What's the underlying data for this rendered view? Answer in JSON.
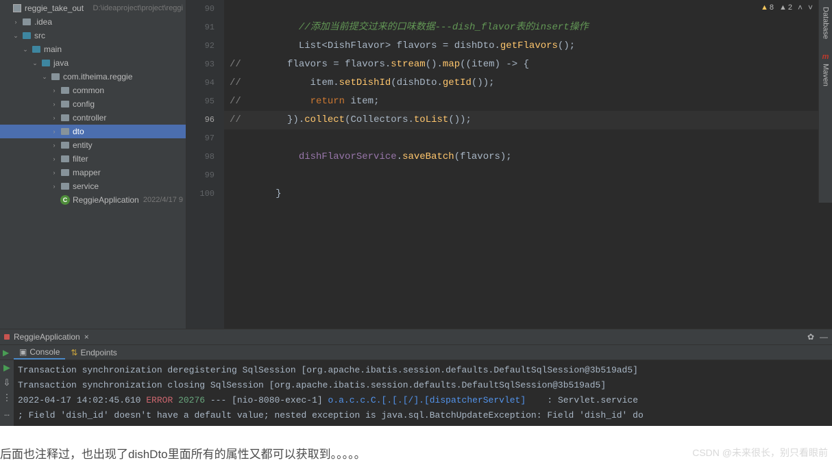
{
  "project": {
    "root": {
      "name": "reggie_take_out",
      "path": "D:\\ideaproject\\project\\reggi"
    },
    "tree": [
      {
        "depth": 0,
        "arrow": "",
        "icon": "module",
        "label": "reggie_take_out",
        "meta": "D:\\ideaproject\\project\\reggi"
      },
      {
        "depth": 1,
        "arrow": ">",
        "icon": "folder",
        "label": ".idea"
      },
      {
        "depth": 1,
        "arrow": "v",
        "icon": "src",
        "label": "src"
      },
      {
        "depth": 2,
        "arrow": "v",
        "icon": "src",
        "label": "main"
      },
      {
        "depth": 3,
        "arrow": "v",
        "icon": "src",
        "label": "java"
      },
      {
        "depth": 4,
        "arrow": "v",
        "icon": "pkg",
        "label": "com.itheima.reggie"
      },
      {
        "depth": 5,
        "arrow": ">",
        "icon": "pkg",
        "label": "common"
      },
      {
        "depth": 5,
        "arrow": ">",
        "icon": "pkg",
        "label": "config"
      },
      {
        "depth": 5,
        "arrow": ">",
        "icon": "pkg",
        "label": "controller"
      },
      {
        "depth": 5,
        "arrow": ">",
        "icon": "pkg",
        "label": "dto",
        "selected": true
      },
      {
        "depth": 5,
        "arrow": ">",
        "icon": "pkg",
        "label": "entity"
      },
      {
        "depth": 5,
        "arrow": ">",
        "icon": "pkg",
        "label": "filter"
      },
      {
        "depth": 5,
        "arrow": ">",
        "icon": "pkg",
        "label": "mapper"
      },
      {
        "depth": 5,
        "arrow": ">",
        "icon": "pkg",
        "label": "service"
      },
      {
        "depth": 5,
        "arrow": "",
        "icon": "cls",
        "label": "ReggieApplication",
        "meta": "2022/4/17 9"
      }
    ]
  },
  "right_tools": {
    "database": "Database",
    "maven": "Maven"
  },
  "editor": {
    "warnings": {
      "yellow": "8",
      "grey": "2"
    },
    "current_line": 96,
    "lines": [
      {
        "n": 90,
        "raw": ""
      },
      {
        "n": 91,
        "comment_zh": "//添加当前提交过来的口味数据---dish_flavor表的insert操作"
      },
      {
        "n": 92,
        "code_html": "List&lt;DishFlavor&gt; flavors = dishDto.getFlavors();"
      },
      {
        "n": 93,
        "code_html": "//        flavors = flavors.stream().map((item) -> {"
      },
      {
        "n": 94,
        "code_html": "//            item.setDishId(dishDto.getId());"
      },
      {
        "n": 95,
        "code_html": "//            return item;"
      },
      {
        "n": 96,
        "code_html": "//        }).collect(Collectors.toList());"
      },
      {
        "n": 97,
        "raw": ""
      },
      {
        "n": 98,
        "code_html": "dishFlavorService.saveBatch(flavors);"
      },
      {
        "n": 99,
        "raw": ""
      },
      {
        "n": 100,
        "raw": "}"
      }
    ]
  },
  "run": {
    "title": "ReggieApplication",
    "tabs": {
      "console": "Console",
      "endpoints": "Endpoints"
    },
    "console": [
      {
        "text": "Transaction synchronization deregistering SqlSession [org.apache.ibatis.session.defaults.DefaultSqlSession@3b519ad5]"
      },
      {
        "text": "Transaction synchronization closing SqlSession [org.apache.ibatis.session.defaults.DefaultSqlSession@3b519ad5]"
      },
      {
        "ts": "2022-04-17 14:02:45.610",
        "level": "ERROR",
        "pid": "20276",
        "sep": " --- [nio-8080-exec-1] ",
        "logger": "o.a.c.c.C.[.[.[/].[dispatcherServlet]",
        "msg": "    : Servlet.service"
      },
      {
        "text": "; Field 'dish_id' doesn't have a default value; nested exception is java.sql.BatchUpdateException: Field 'dish_id' do"
      }
    ]
  },
  "footer": {
    "text": "后面也注释过，也出现了dishDto里面所有的属性又都可以获取到。。。。。",
    "watermark": "CSDN @未来很长，别只看眼前"
  }
}
